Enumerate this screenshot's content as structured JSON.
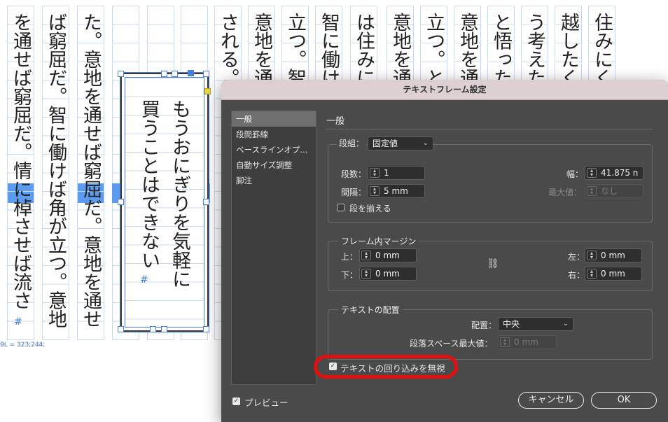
{
  "document": {
    "columns": [
      {
        "text": "住みにく"
      },
      {
        "text": "越したく"
      },
      {
        "text": "う考えた"
      },
      {
        "text": "と悟った"
      },
      {
        "text": "意地を通"
      },
      {
        "text": "立つ。と"
      },
      {
        "text": "意地を通"
      },
      {
        "text": "は住みに"
      },
      {
        "text": "智に働け"
      },
      {
        "text": "立つ。智"
      },
      {
        "text": "意地を通"
      },
      {
        "text": "される。"
      },
      {
        "text": "た。意地を通せば窮屈だ。意地を通せ"
      },
      {
        "text": "ば窮屈だ。智に働けば角が立つ。意地"
      },
      {
        "text": "を通せば窮屈だ。情に棹させば流さ"
      }
    ],
    "selected_frame_lines": [
      "もうおにぎりを気軽に",
      "買うことはできない"
    ],
    "status_readout": "9L = 323;244;",
    "highlight_color": "#5b9cf0"
  },
  "dialog": {
    "title": "テキストフレーム設定",
    "sidebar": [
      "一般",
      "段間罫線",
      "ベースラインオプ...",
      "自動サイズ調整",
      "脚注"
    ],
    "section_title": "一般",
    "columns_group": {
      "type_label": "段組：",
      "type_value": "固定値",
      "count_label": "段数：",
      "count_value": "1",
      "width_label": "幅：",
      "width_value": "41.875 n",
      "gutter_label": "間隔：",
      "gutter_value": "5 mm",
      "max_label": "最大値：",
      "max_value": "なし",
      "balance_label": "段を揃える"
    },
    "inset_group": {
      "title": "フレーム内マージン",
      "top_label": "上：",
      "top_value": "0 mm",
      "bottom_label": "下：",
      "bottom_value": "0 mm",
      "left_label": "左：",
      "left_value": "0 mm",
      "right_label": "右：",
      "right_value": "0 mm"
    },
    "align_group": {
      "title": "テキストの配置",
      "align_label": "配置：",
      "align_value": "中央",
      "para_space_label": "段落スペース最大値：",
      "para_space_value": "0 mm"
    },
    "ignore_wrap_label": "テキストの回り込みを無視",
    "ignore_wrap_checked": true,
    "preview_label": "プレビュー",
    "preview_checked": true,
    "cancel_label": "キャンセル",
    "ok_label": "OK",
    "annotation_color": "#e01010"
  }
}
